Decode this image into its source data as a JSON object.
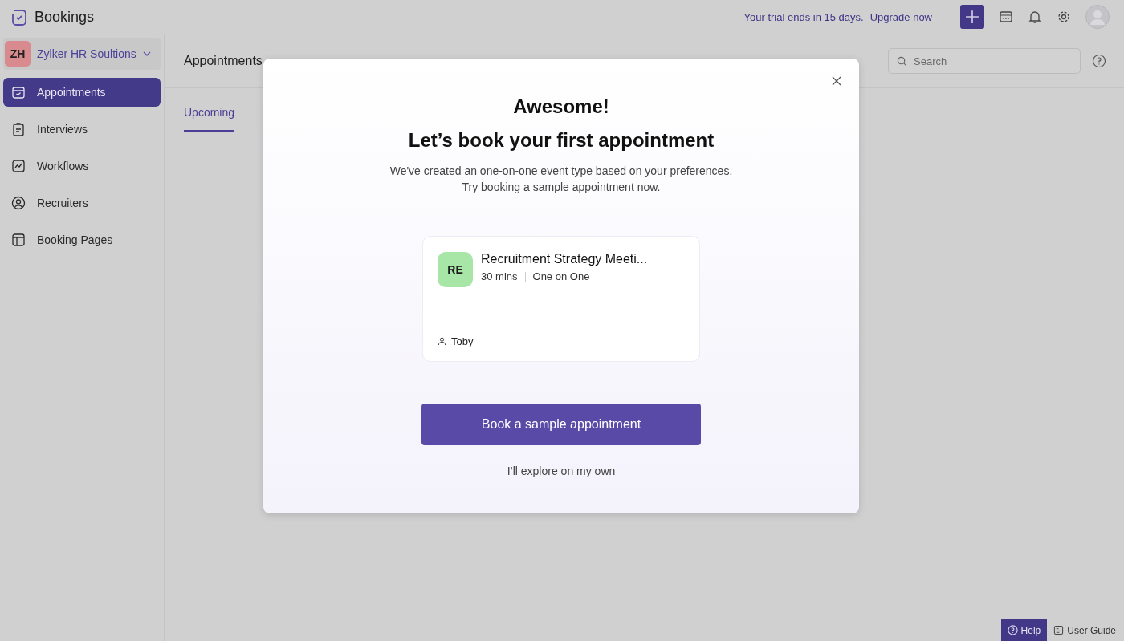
{
  "app": {
    "title": "Bookings"
  },
  "topbar": {
    "trial_text": "Your trial ends in 15 days.",
    "upgrade_link": "Upgrade now"
  },
  "workspace": {
    "initials": "ZH",
    "name": "Zylker HR Soultions",
    "color": "#d98a8e"
  },
  "sidebar": {
    "items": [
      {
        "label": "Appointments",
        "selected": true
      },
      {
        "label": "Interviews",
        "selected": false
      },
      {
        "label": "Workflows",
        "selected": false
      },
      {
        "label": "Recruiters",
        "selected": false
      },
      {
        "label": "Booking Pages",
        "selected": false
      }
    ]
  },
  "content": {
    "title": "Appointments",
    "search": {
      "placeholder": "Search"
    },
    "tabs": [
      {
        "label": "Upcoming",
        "selected": true
      }
    ]
  },
  "modal": {
    "title": "Awesome!",
    "subtitle": "Let’s book your first appointment",
    "description": [
      "We've created an one-on-one event type based on your preferences.",
      "Try booking a sample appointment now."
    ],
    "event": {
      "initials": "RE",
      "color": "#a8e6a8",
      "name": "Recruitment Strategy Meeti...",
      "duration": "30 mins",
      "type": "One on One",
      "host": "Toby"
    },
    "primary_button": "Book a sample appointment",
    "secondary_link": "I’ll explore on my own"
  },
  "footer": {
    "help": "Help",
    "guide": "User Guide"
  }
}
